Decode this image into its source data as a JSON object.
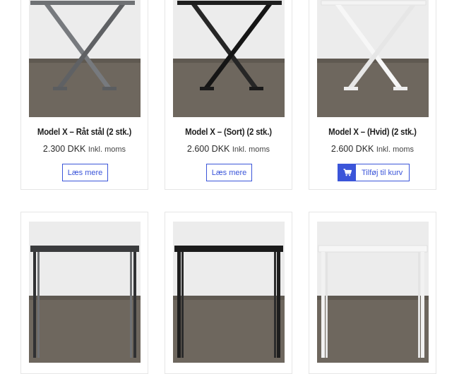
{
  "products": [
    {
      "title": "Model X – Råt stål (2 stk.)",
      "price": "2.300 DKK",
      "vat": "Inkl. moms",
      "button": "Læs mere"
    },
    {
      "title": "Model X – (Sort) (2 stk.)",
      "price": "2.600 DKK",
      "vat": "Inkl. moms",
      "button": "Læs mere"
    },
    {
      "title": "Model X – (Hvid) (2 stk.)",
      "price": "2.600 DKK",
      "vat": "Inkl. moms",
      "button": "Tilføj til kurv"
    }
  ],
  "colors": {
    "accent": "#3b55d9",
    "wall": "#ececec",
    "floor": "#6e675e",
    "raw_steel": "#6f7174",
    "black_steel": "#1e1e1e",
    "white_steel": "#f4f4f4"
  },
  "icons": {
    "cart": "cart-icon"
  }
}
